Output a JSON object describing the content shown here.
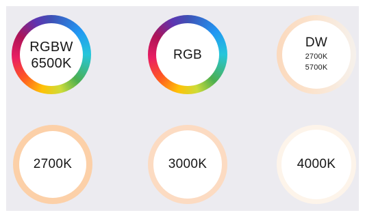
{
  "options": [
    {
      "lines": [
        "RGBW",
        "6500K"
      ],
      "ring": "rainbow"
    },
    {
      "lines": [
        "RGB"
      ],
      "ring": "rainbow"
    },
    {
      "title": "DW",
      "sub_lines": [
        "2700K",
        "5700K"
      ],
      "ring_color": "#fbdcc1",
      "ring_color_alt": "#f7f4f1"
    },
    {
      "lines": [
        "2700K"
      ],
      "ring_color": "#fcd0a8"
    },
    {
      "lines": [
        "3000K"
      ],
      "ring_color": "#fcdbc2"
    },
    {
      "lines": [
        "4000K"
      ],
      "ring_color": "#fdf4ea"
    }
  ]
}
